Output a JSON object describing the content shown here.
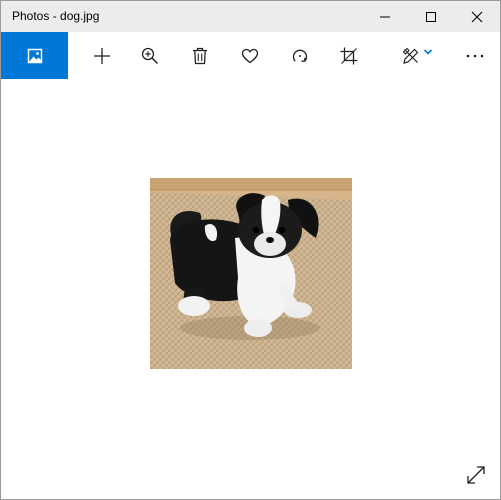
{
  "window": {
    "title": "Photos - dog.jpg"
  },
  "toolbar": {
    "buttons": [
      {
        "name": "see-all-photos",
        "icon": "photo-icon"
      },
      {
        "name": "add-to",
        "icon": "plus-icon"
      },
      {
        "name": "zoom",
        "icon": "zoom-in-icon"
      },
      {
        "name": "delete",
        "icon": "trash-icon"
      },
      {
        "name": "favorite",
        "icon": "heart-icon"
      },
      {
        "name": "rotate",
        "icon": "rotate-icon"
      },
      {
        "name": "crop",
        "icon": "crop-icon"
      },
      {
        "name": "edit-create",
        "icon": "edit-create-icon"
      },
      {
        "name": "see-more",
        "icon": "more-icon"
      }
    ]
  },
  "colors": {
    "accent": "#0078d7",
    "titlebar_bg": "#ececec",
    "icon": "#222222"
  },
  "image": {
    "subject": "dog"
  }
}
